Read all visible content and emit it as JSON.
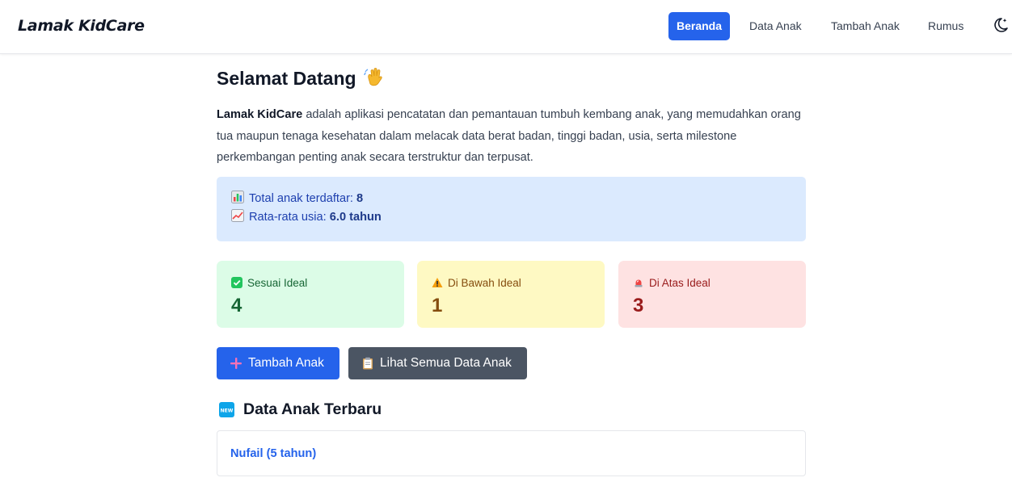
{
  "app": {
    "brand": "Lamak KidCare"
  },
  "nav": {
    "items": [
      {
        "label": "Beranda",
        "active": true
      },
      {
        "label": "Data Anak",
        "active": false
      },
      {
        "label": "Tambah Anak",
        "active": false
      },
      {
        "label": "Rumus",
        "active": false
      }
    ],
    "theme_toggle_icon": "moon-icon"
  },
  "main": {
    "title": "Selamat Datang",
    "title_icon": "waving-hand-icon",
    "intro": {
      "brand_bold": "Lamak KidCare",
      "text": " adalah aplikasi pencatatan dan pemantauan tumbuh kembang anak, yang memudahkan orang tua maupun tenaga kesehatan dalam melacak data berat badan, tinggi badan, usia, serta milestone perkembangan penting anak secara terstruktur dan terpusat."
    },
    "stats": {
      "total_label": "Total anak terdaftar: ",
      "total_value": "8",
      "avg_label": "Rata-rata usia: ",
      "avg_value": "6.0 tahun"
    },
    "cards": [
      {
        "label": "Sesuai Ideal",
        "count": "4",
        "icon": "check-icon",
        "color": "#166534"
      },
      {
        "label": "Di Bawah Ideal",
        "count": "1",
        "icon": "warning-icon",
        "color": "#854d0e"
      },
      {
        "label": "Di Atas Ideal",
        "count": "3",
        "icon": "siren-icon",
        "color": "#991b1b"
      }
    ],
    "buttons": {
      "tambah": "Tambah Anak",
      "lihat": "Lihat Semua Data Anak"
    },
    "latest": {
      "title": "Data Anak Terbaru",
      "items": [
        "Nufail (5 tahun)"
      ]
    }
  },
  "colors": {
    "primary": "#2563eb",
    "secondary": "#4b5563",
    "info_bg": "#dbeafe",
    "success_bg": "#dcfce7",
    "warning_bg": "#fef9c3",
    "danger_bg": "#fee2e2"
  }
}
